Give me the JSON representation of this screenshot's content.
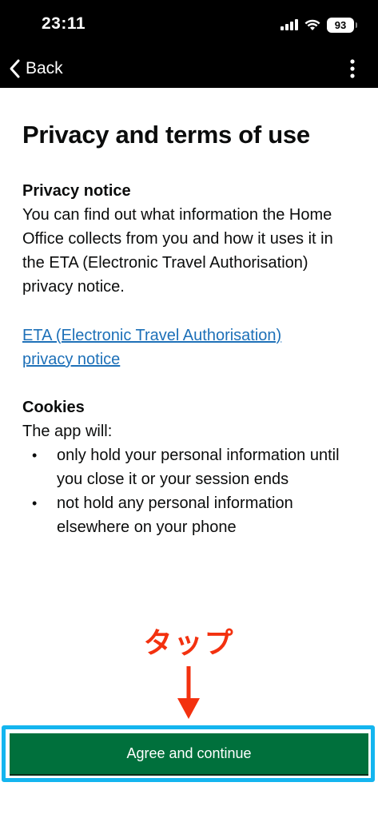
{
  "status_bar": {
    "time": "23:11",
    "battery": "93"
  },
  "nav": {
    "back_label": "Back"
  },
  "page": {
    "title": "Privacy and terms of use",
    "privacy": {
      "heading": "Privacy notice",
      "body": "You can find out what information the Home Office collects from you and how it uses it in the ETA (Electronic Travel Authorisation) privacy notice.",
      "link": "ETA (Electronic Travel Authorisation) privacy notice"
    },
    "cookies": {
      "heading": "Cookies",
      "intro": "The app will:",
      "items": [
        "only hold your personal information until you close it or your session ends",
        "not hold any personal information elsewhere on your phone"
      ]
    }
  },
  "annotation": {
    "label": "タップ",
    "color": "#f3310f",
    "frame_color": "#14b5ef"
  },
  "actions": {
    "agree_label": "Agree and continue",
    "button_color": "#00703c"
  }
}
